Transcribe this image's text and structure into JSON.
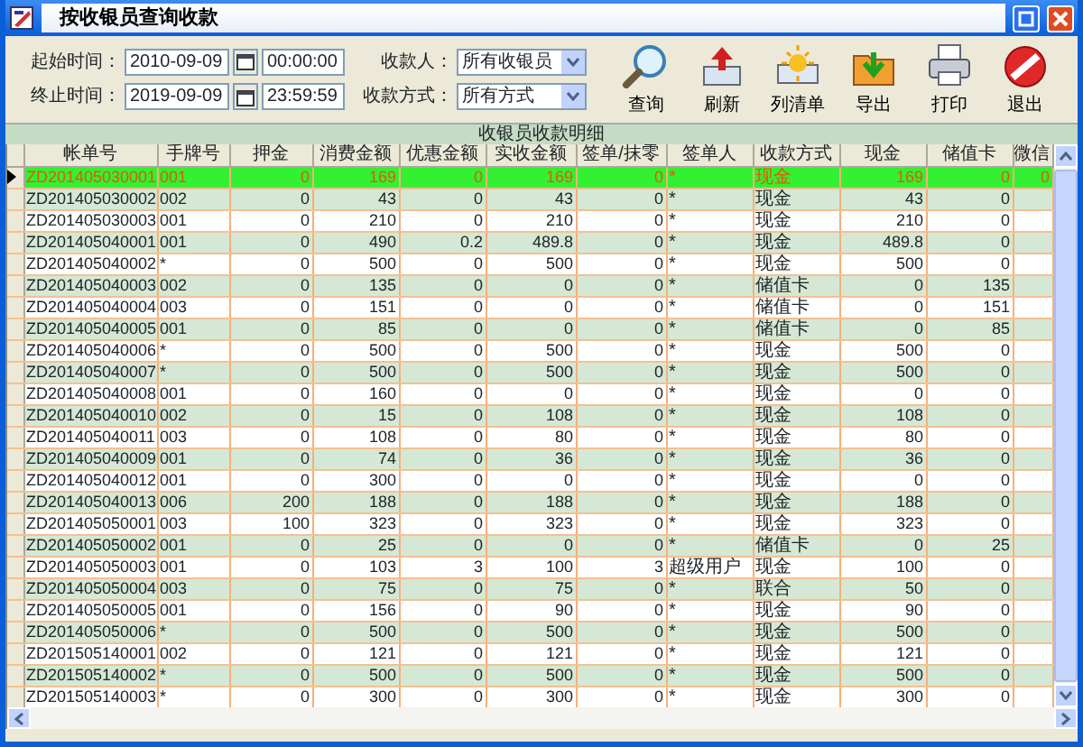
{
  "window": {
    "title": "按收银员查询收款"
  },
  "filters": {
    "start_label": "起始时间：",
    "start_date": "2010-09-09",
    "start_time": "00:00:00",
    "end_label": "终止时间：",
    "end_date": "2019-09-09",
    "end_time": "23:59:59",
    "cashier_label": "收款人：",
    "cashier_value": "所有收银员",
    "method_label": "收款方式：",
    "method_value": "所有方式"
  },
  "toolbar": [
    {
      "label": "查询",
      "kind": "search"
    },
    {
      "label": "刷新",
      "kind": "refresh"
    },
    {
      "label": "列清单",
      "kind": "list"
    },
    {
      "label": "导出",
      "kind": "export"
    },
    {
      "label": "打印",
      "kind": "print"
    },
    {
      "label": "退出",
      "kind": "exit"
    }
  ],
  "section_title": "收银员收款明细",
  "table": {
    "columns": [
      "帐单号",
      "手牌号",
      "押金",
      "消费金额",
      "优惠金额",
      "实收金额",
      "签单/抹零",
      "签单人",
      "收款方式",
      "现金",
      "储值卡",
      "微信"
    ],
    "rows": [
      {
        "selected": true,
        "cells": [
          "ZD201405030001",
          "001",
          "0",
          "169",
          "0",
          "169",
          "0",
          "*",
          "现金",
          "169",
          "0",
          "0"
        ]
      },
      {
        "selected": false,
        "cells": [
          "ZD201405030002",
          "002",
          "0",
          "43",
          "0",
          "43",
          "0",
          "*",
          "现金",
          "43",
          "0"
        ]
      },
      {
        "selected": false,
        "cells": [
          "ZD201405030003",
          "001",
          "0",
          "210",
          "0",
          "210",
          "0",
          "*",
          "现金",
          "210",
          "0"
        ]
      },
      {
        "selected": false,
        "cells": [
          "ZD201405040001",
          "001",
          "0",
          "490",
          "0.2",
          "489.8",
          "0",
          "*",
          "现金",
          "489.8",
          "0"
        ]
      },
      {
        "selected": false,
        "cells": [
          "ZD201405040002",
          "*",
          "0",
          "500",
          "0",
          "500",
          "0",
          "*",
          "现金",
          "500",
          "0"
        ]
      },
      {
        "selected": false,
        "cells": [
          "ZD201405040003",
          "002",
          "0",
          "135",
          "0",
          "0",
          "0",
          "*",
          "储值卡",
          "0",
          "135"
        ]
      },
      {
        "selected": false,
        "cells": [
          "ZD201405040004",
          "003",
          "0",
          "151",
          "0",
          "0",
          "0",
          "*",
          "储值卡",
          "0",
          "151"
        ]
      },
      {
        "selected": false,
        "cells": [
          "ZD201405040005",
          "001",
          "0",
          "85",
          "0",
          "0",
          "0",
          "*",
          "储值卡",
          "0",
          "85"
        ]
      },
      {
        "selected": false,
        "cells": [
          "ZD201405040006",
          "*",
          "0",
          "500",
          "0",
          "500",
          "0",
          "*",
          "现金",
          "500",
          "0"
        ]
      },
      {
        "selected": false,
        "cells": [
          "ZD201405040007",
          "*",
          "0",
          "500",
          "0",
          "500",
          "0",
          "*",
          "现金",
          "500",
          "0"
        ]
      },
      {
        "selected": false,
        "cells": [
          "ZD201405040008",
          "001",
          "0",
          "160",
          "0",
          "0",
          "0",
          "*",
          "现金",
          "0",
          "0"
        ]
      },
      {
        "selected": false,
        "cells": [
          "ZD201405040010",
          "002",
          "0",
          "15",
          "0",
          "108",
          "0",
          "*",
          "现金",
          "108",
          "0"
        ]
      },
      {
        "selected": false,
        "cells": [
          "ZD201405040011",
          "003",
          "0",
          "108",
          "0",
          "80",
          "0",
          "*",
          "现金",
          "80",
          "0"
        ]
      },
      {
        "selected": false,
        "cells": [
          "ZD201405040009",
          "001",
          "0",
          "74",
          "0",
          "36",
          "0",
          "*",
          "现金",
          "36",
          "0"
        ]
      },
      {
        "selected": false,
        "cells": [
          "ZD201405040012",
          "001",
          "0",
          "300",
          "0",
          "0",
          "0",
          "*",
          "现金",
          "0",
          "0"
        ]
      },
      {
        "selected": false,
        "cells": [
          "ZD201405040013",
          "006",
          "200",
          "188",
          "0",
          "188",
          "0",
          "*",
          "现金",
          "188",
          "0"
        ]
      },
      {
        "selected": false,
        "cells": [
          "ZD201405050001",
          "003",
          "100",
          "323",
          "0",
          "323",
          "0",
          "*",
          "现金",
          "323",
          "0"
        ]
      },
      {
        "selected": false,
        "cells": [
          "ZD201405050002",
          "001",
          "0",
          "25",
          "0",
          "0",
          "0",
          "*",
          "储值卡",
          "0",
          "25"
        ]
      },
      {
        "selected": false,
        "cells": [
          "ZD201405050003",
          "001",
          "0",
          "103",
          "3",
          "100",
          "3",
          "超级用户",
          "现金",
          "100",
          "0"
        ]
      },
      {
        "selected": false,
        "cells": [
          "ZD201405050004",
          "003",
          "0",
          "75",
          "0",
          "75",
          "0",
          "*",
          "联合",
          "50",
          "0"
        ]
      },
      {
        "selected": false,
        "cells": [
          "ZD201405050005",
          "001",
          "0",
          "156",
          "0",
          "90",
          "0",
          "*",
          "现金",
          "90",
          "0"
        ]
      },
      {
        "selected": false,
        "cells": [
          "ZD201405050006",
          "*",
          "0",
          "500",
          "0",
          "500",
          "0",
          "*",
          "现金",
          "500",
          "0"
        ]
      },
      {
        "selected": false,
        "cells": [
          "ZD201505140001",
          "002",
          "0",
          "121",
          "0",
          "121",
          "0",
          "*",
          "现金",
          "121",
          "0"
        ]
      },
      {
        "selected": false,
        "cells": [
          "ZD201505140002",
          "*",
          "0",
          "500",
          "0",
          "500",
          "0",
          "*",
          "现金",
          "500",
          "0"
        ]
      },
      {
        "selected": false,
        "cells": [
          "ZD201505140003",
          "*",
          "0",
          "300",
          "0",
          "300",
          "0",
          "*",
          "现金",
          "300",
          "0"
        ]
      }
    ]
  }
}
